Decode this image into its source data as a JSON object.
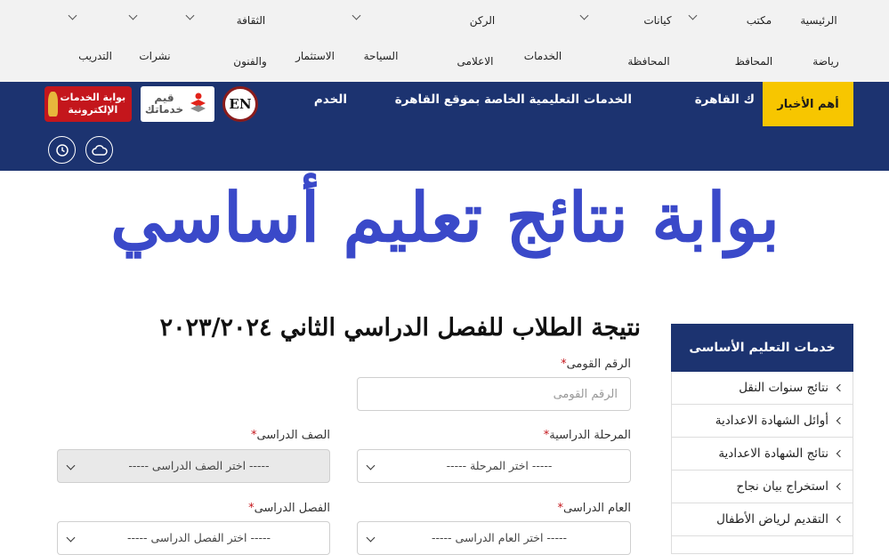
{
  "top_nav": {
    "row1": [
      {
        "label": "الرئيسية",
        "has_dropdown": false
      },
      {
        "label": "مكتب",
        "has_dropdown": true
      },
      {
        "label": "كيانات",
        "has_dropdown": true
      },
      {
        "label": "الركن",
        "has_dropdown": true
      },
      {
        "label": "الثقافة",
        "has_dropdown": true
      },
      {
        "label": "",
        "has_dropdown": true
      },
      {
        "label": "",
        "has_dropdown": true
      }
    ],
    "row2": [
      {
        "label": "رياضة"
      },
      {
        "label": "المحافظ"
      },
      {
        "label": "المحافظة"
      },
      {
        "label": "الخدمات"
      },
      {
        "label": "الاعلامى"
      },
      {
        "label": "السياحة"
      },
      {
        "label": "الاستثمار"
      },
      {
        "label": "والفنون"
      },
      {
        "label": "نشرات"
      },
      {
        "label": "التدريب"
      }
    ]
  },
  "header": {
    "news_label": "أهم الأخبار",
    "ticker": [
      "ك القاهرة",
      "الخدمات التعليمية الخاصة بموقع القاهرة",
      "الخدم"
    ],
    "logos": {
      "en": "EN",
      "qayem": "قيم خدماتك",
      "gov_portal": "بوابة الخدمات الإلكترونية"
    },
    "icons": [
      "cloud-icon",
      "clock-icon"
    ]
  },
  "hero": {
    "title": "بوابة نتائج تعليم أساسي",
    "result_title": "نتيجة الطلاب للفصل الدراسي الثاني ٢٠٢٣/٢٠٢٤"
  },
  "form": {
    "national_id": {
      "label": "الرقم القومى",
      "placeholder": "الرقم القومى"
    },
    "stage": {
      "label": "المرحلة الدراسية",
      "value": "----- اختر المرحلة -----"
    },
    "grade": {
      "label": "الصف الدراسى",
      "value": "----- اختر الصف الدراسى -----"
    },
    "year": {
      "label": "العام الدراسى",
      "value": "----- اختر العام الدراسى -----"
    },
    "term": {
      "label": "الفصل الدراسى",
      "value": "----- اختر الفصل الدراسى -----"
    },
    "required_mark": "*"
  },
  "sidebar": {
    "title": "خدمات التعليم الأساسى",
    "items": [
      "نتائج سنوات النقل",
      "أوائل الشهادة الاعدادية",
      "نتائج الشهادة الاعدادية",
      "استخراج بيان نجاح",
      "التقديم لرياض الأطفال"
    ]
  },
  "colors": {
    "header_blue": "#1c3370",
    "news_yellow": "#f7c600",
    "hero_blue": "#3a49c9",
    "gov_red": "#c4161c"
  }
}
